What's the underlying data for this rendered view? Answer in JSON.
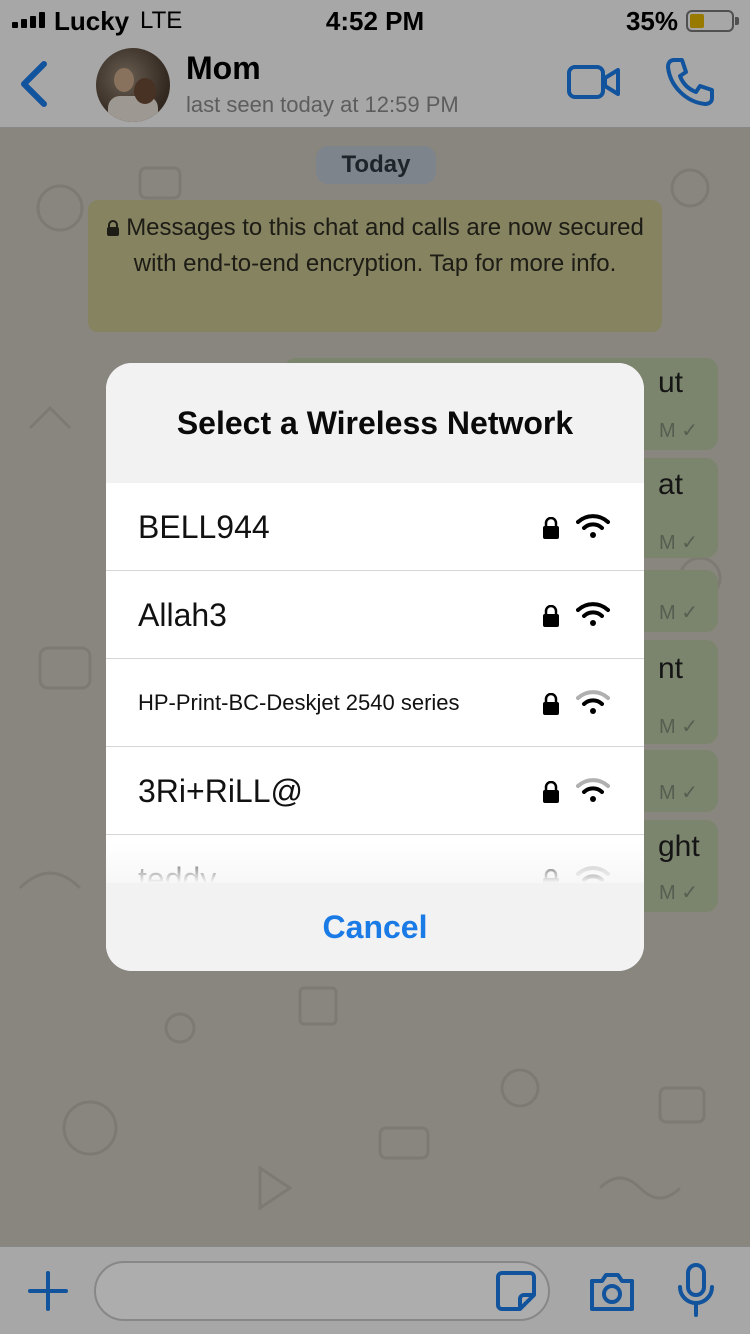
{
  "status_bar": {
    "carrier": "Lucky",
    "network": "LTE",
    "time": "4:52 PM",
    "battery_pct": "35%",
    "battery_level": 0.35
  },
  "header": {
    "contact_name": "Mom",
    "last_seen": "last seen today at 12:59 PM",
    "accent_color": "#1a7be6"
  },
  "chat": {
    "date_chip": "Today",
    "encryption_notice": "Messages to this chat and calls are now secured with end-to-end encryption. Tap for more info.",
    "bubbles": [
      {
        "fragment": "ut",
        "meta": "M ✓"
      },
      {
        "fragment": "at",
        "meta": "M ✓"
      },
      {
        "fragment": "",
        "meta": "M ✓"
      },
      {
        "fragment": "nt",
        "meta": "M ✓"
      },
      {
        "fragment": "",
        "meta": "M ✓"
      },
      {
        "fragment": "ght",
        "meta": "M ✓"
      }
    ]
  },
  "wireless_sheet": {
    "title": "Select a Wireless Network",
    "networks": [
      {
        "ssid": "BELL944"
      },
      {
        "ssid": "Allah3"
      },
      {
        "ssid": "HP-Print-BC-Deskjet 2540 series"
      },
      {
        "ssid": "3Ri+RiLL@"
      },
      {
        "ssid": "teddy"
      }
    ],
    "cancel_label": "Cancel"
  }
}
